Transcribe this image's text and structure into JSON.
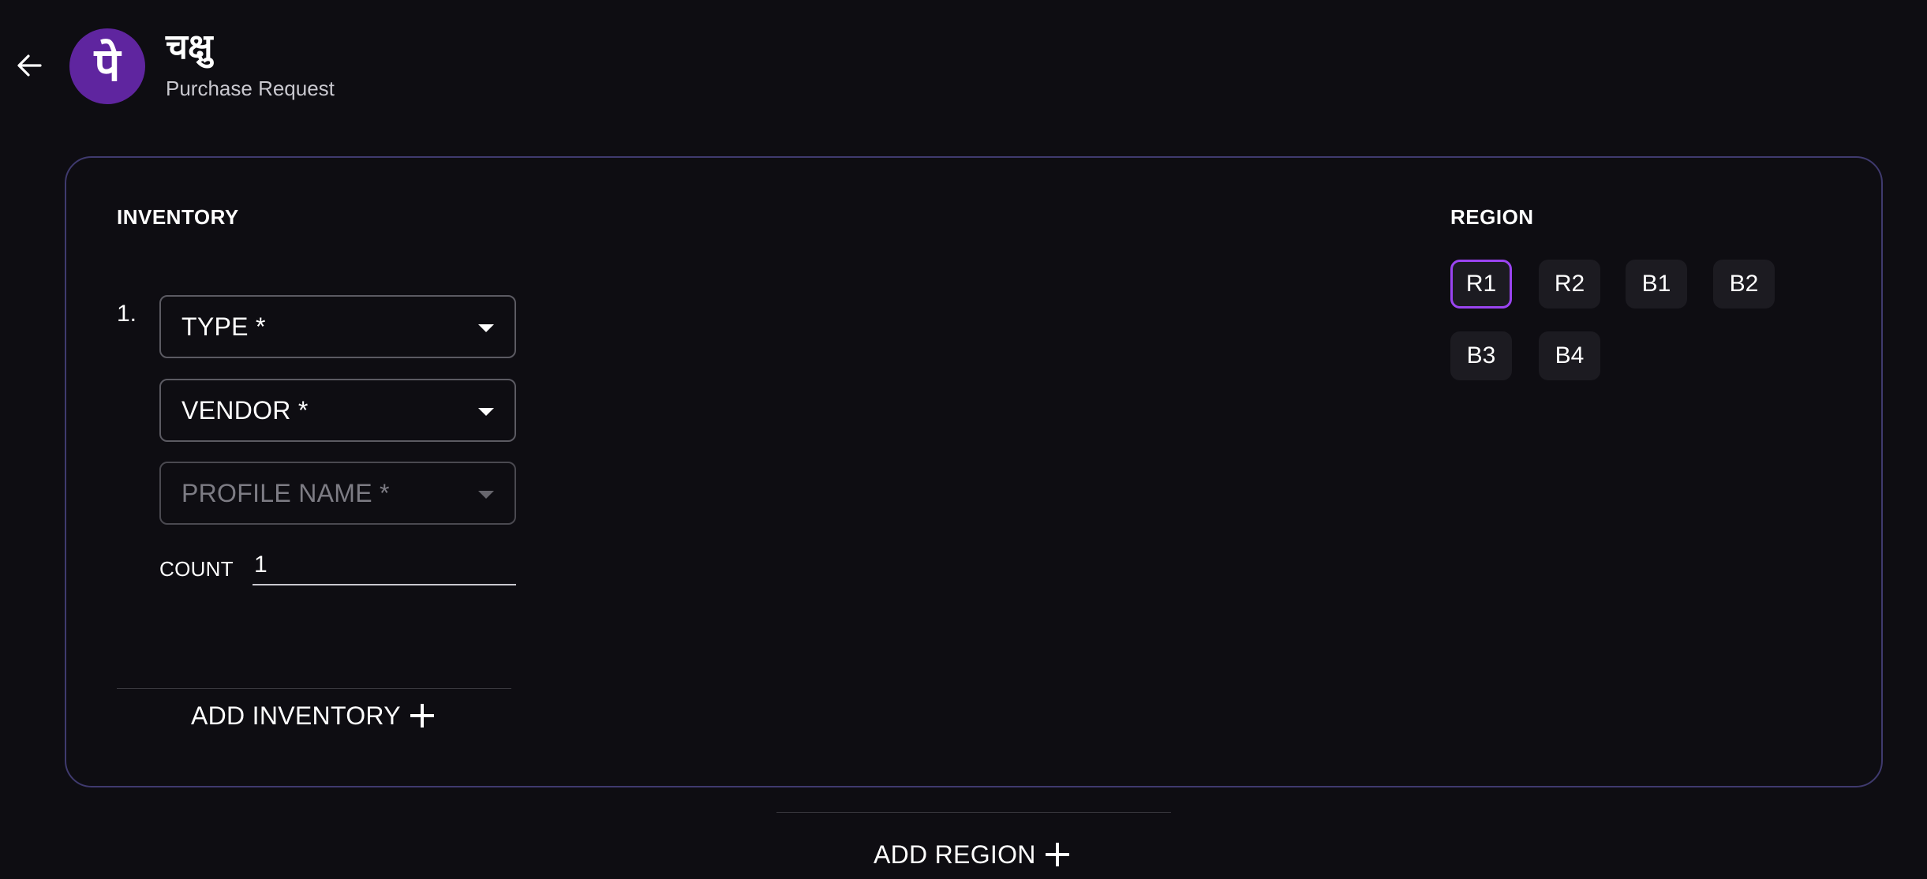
{
  "header": {
    "logo_glyph": "पे",
    "title": "चक्षु",
    "subtitle": "Purchase Request"
  },
  "inventory": {
    "title": "INVENTORY",
    "items": [
      {
        "number": "1.",
        "type_label": "TYPE *",
        "vendor_label": "VENDOR *",
        "profile_label": "PROFILE NAME *",
        "count_label": "COUNT",
        "count_value": "1"
      }
    ],
    "add_label": "ADD INVENTORY"
  },
  "region": {
    "title": "REGION",
    "chips": [
      {
        "label": "R1",
        "selected": true
      },
      {
        "label": "R2",
        "selected": false
      },
      {
        "label": "B1",
        "selected": false
      },
      {
        "label": "B2",
        "selected": false
      },
      {
        "label": "B3",
        "selected": false
      },
      {
        "label": "B4",
        "selected": false
      }
    ],
    "accent_color": "#9a44f0"
  },
  "footer": {
    "add_region_label": "ADD REGION"
  },
  "colors": {
    "background": "#0e0d12",
    "logo_bg": "#5f259f",
    "card_border": "#3f3a6e"
  }
}
